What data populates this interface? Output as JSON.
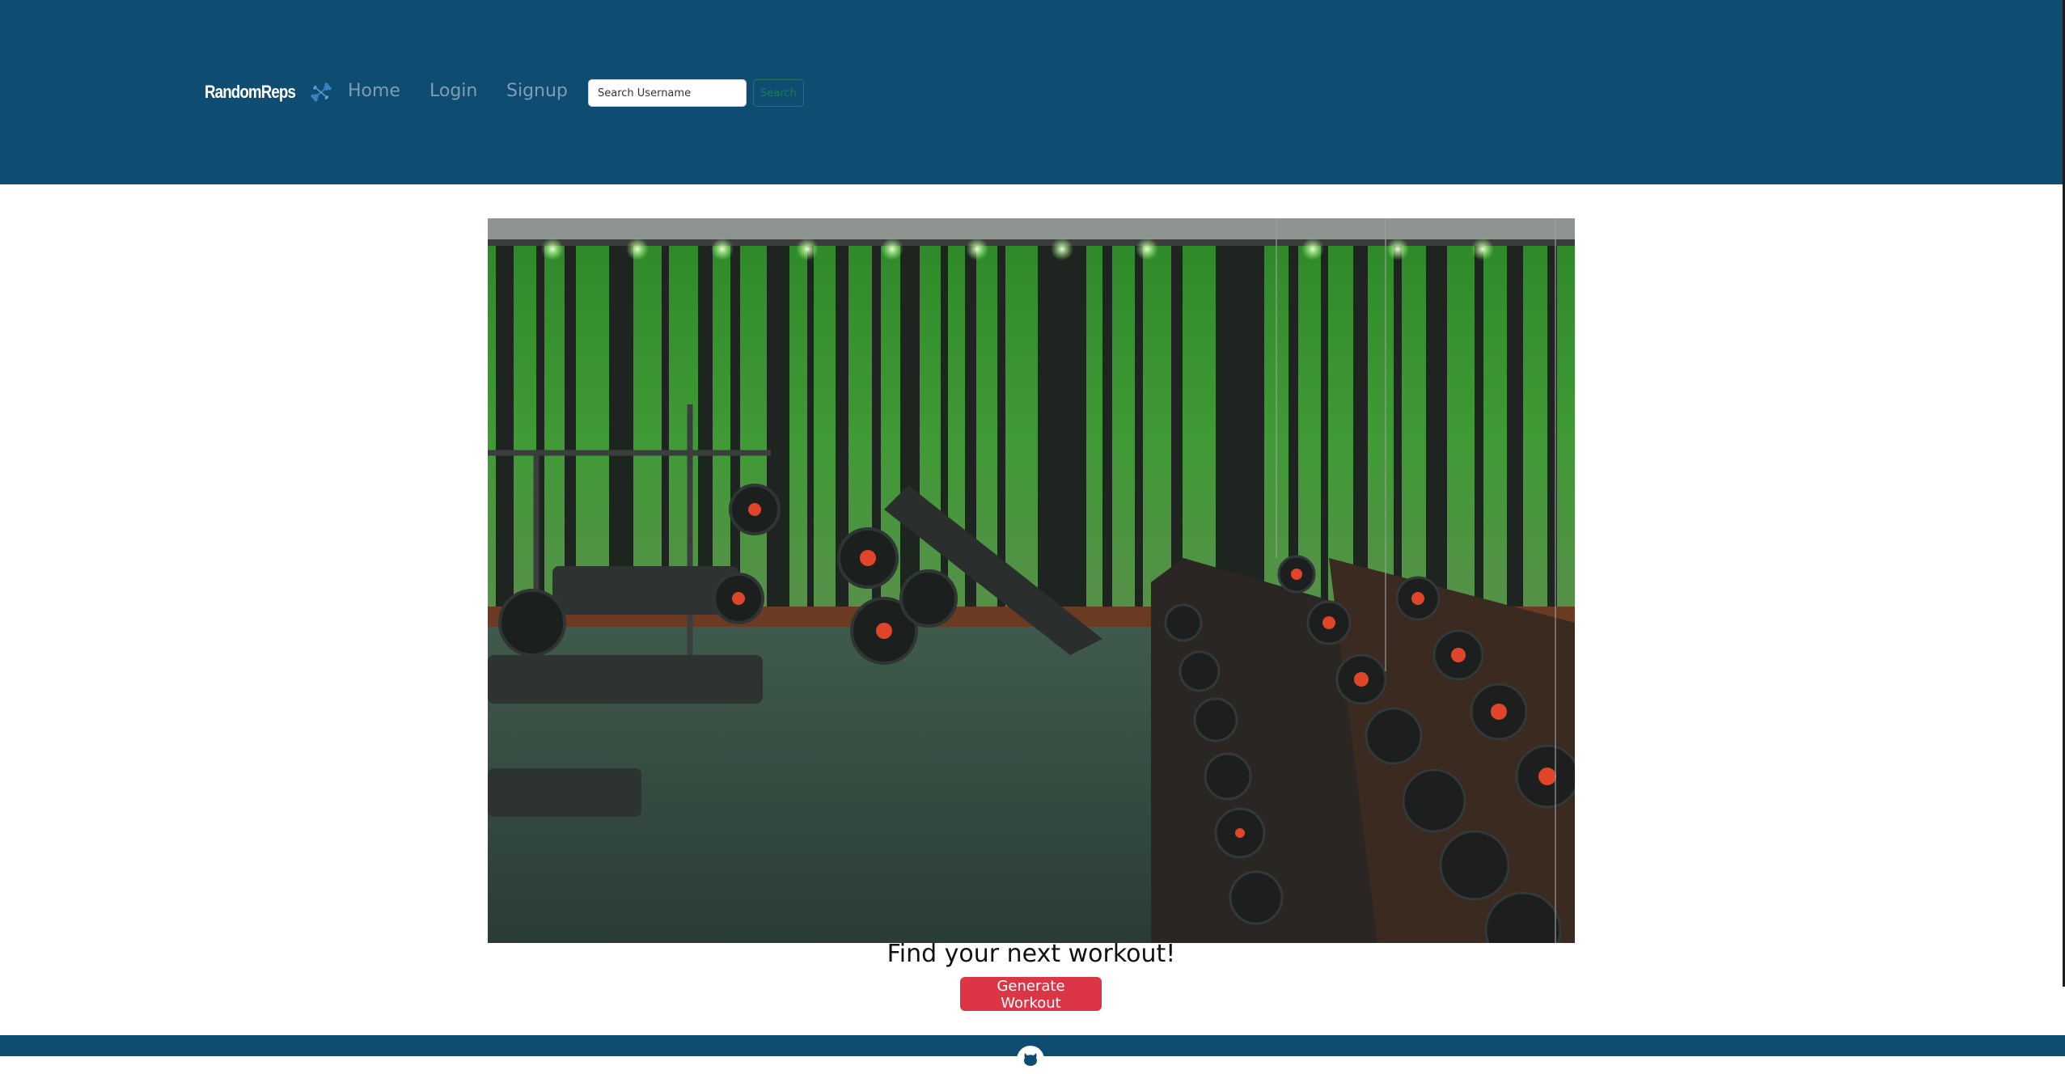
{
  "brand": {
    "name": "RandomReps",
    "icon": "dumbbell-icon"
  },
  "nav": {
    "links": [
      {
        "label": "Home"
      },
      {
        "label": "Login"
      },
      {
        "label": "Signup"
      }
    ]
  },
  "search": {
    "placeholder": "Search Username",
    "value": "",
    "button_label": "Search"
  },
  "hero": {
    "image": "gym-interior-forest-mural"
  },
  "main": {
    "tagline": "Find your next workout!",
    "generate_label": "Generate Workout"
  },
  "footer": {
    "icon": "github-icon"
  },
  "colors": {
    "navbar": "#0f4c72",
    "accent_red": "#dc3545",
    "search_green": "#1e7a57",
    "nav_link": "#7f9db3"
  }
}
